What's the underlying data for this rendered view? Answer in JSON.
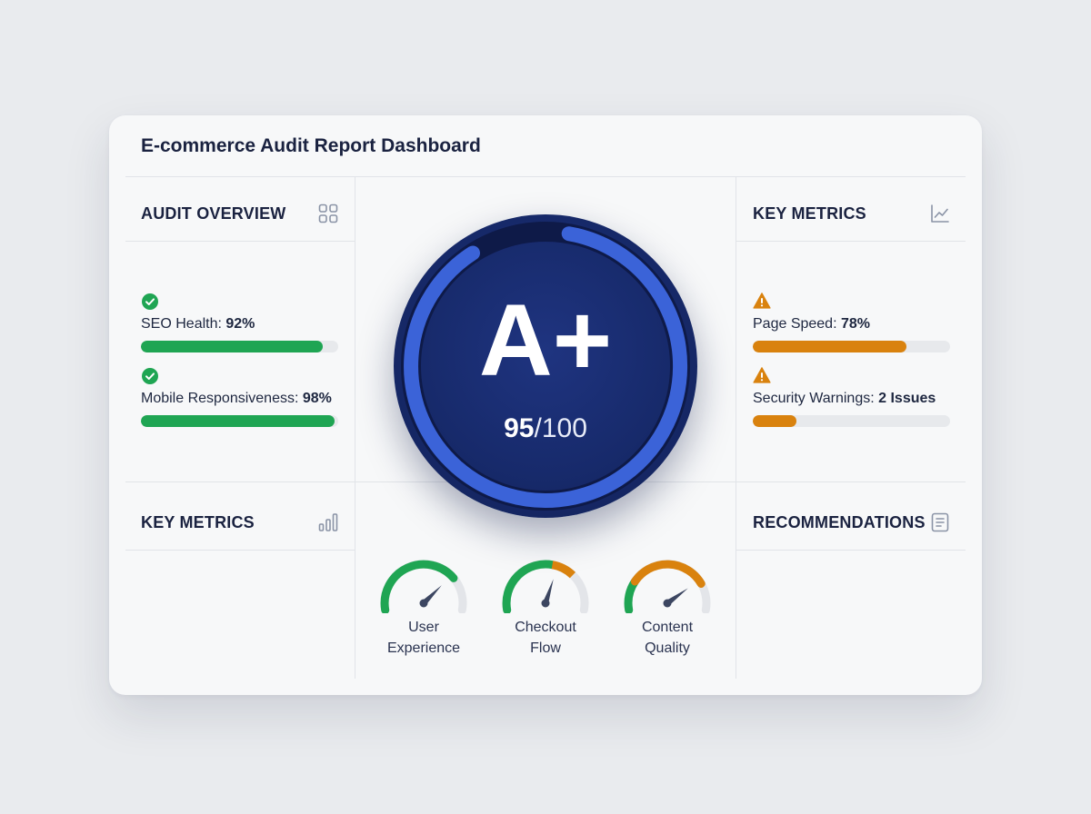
{
  "dashboard": {
    "title": "E-commerce Audit Report Dashboard"
  },
  "audit_overview": {
    "title": "AUDIT OVERVIEW",
    "icon": "grid-icon",
    "metrics": [
      {
        "label": "SEO Health: ",
        "value": "92%",
        "percent": 92,
        "status": "check-circle-icon",
        "color": "#1fa553"
      },
      {
        "label": "Mobile Responsiveness: ",
        "value": "98%",
        "percent": 98,
        "status": "check-circle-icon",
        "color": "#1fa553"
      }
    ]
  },
  "key_metrics_top": {
    "title": "KEY METRICS",
    "icon": "line-chart-icon",
    "metrics": [
      {
        "label": "Page Speed: ",
        "value": "78%",
        "percent": 78,
        "status": "warning-icon",
        "color": "#d9820e"
      },
      {
        "label": "Security Warnings: ",
        "value": "2 Issues",
        "percent": 22,
        "status": "warning-icon",
        "color": "#d9820e"
      }
    ]
  },
  "key_metrics_bottom": {
    "title": "KEY METRICS",
    "icon": "bar-chart-icon"
  },
  "recommendations": {
    "title": "RECOMMENDATIONS",
    "icon": "document-icon"
  },
  "score": {
    "grade": "A+",
    "value": "95",
    "suffix": "/100",
    "percent": 95
  },
  "gauges": [
    {
      "line1": "User",
      "line2": "Experience",
      "level": 0.75,
      "color": "#1fa553"
    },
    {
      "line1": "Checkout",
      "line2": "Flow",
      "level": 0.6,
      "color": "#1fa553",
      "accent": "#d9820e"
    },
    {
      "line1": "Content",
      "line2": "Quality",
      "level": 0.8,
      "color": "#d9820e"
    }
  ],
  "colors": {
    "green": "#1fa553",
    "orange": "#d9820e",
    "navy": "#172a6b",
    "ring_blue": "#3b63d8"
  }
}
